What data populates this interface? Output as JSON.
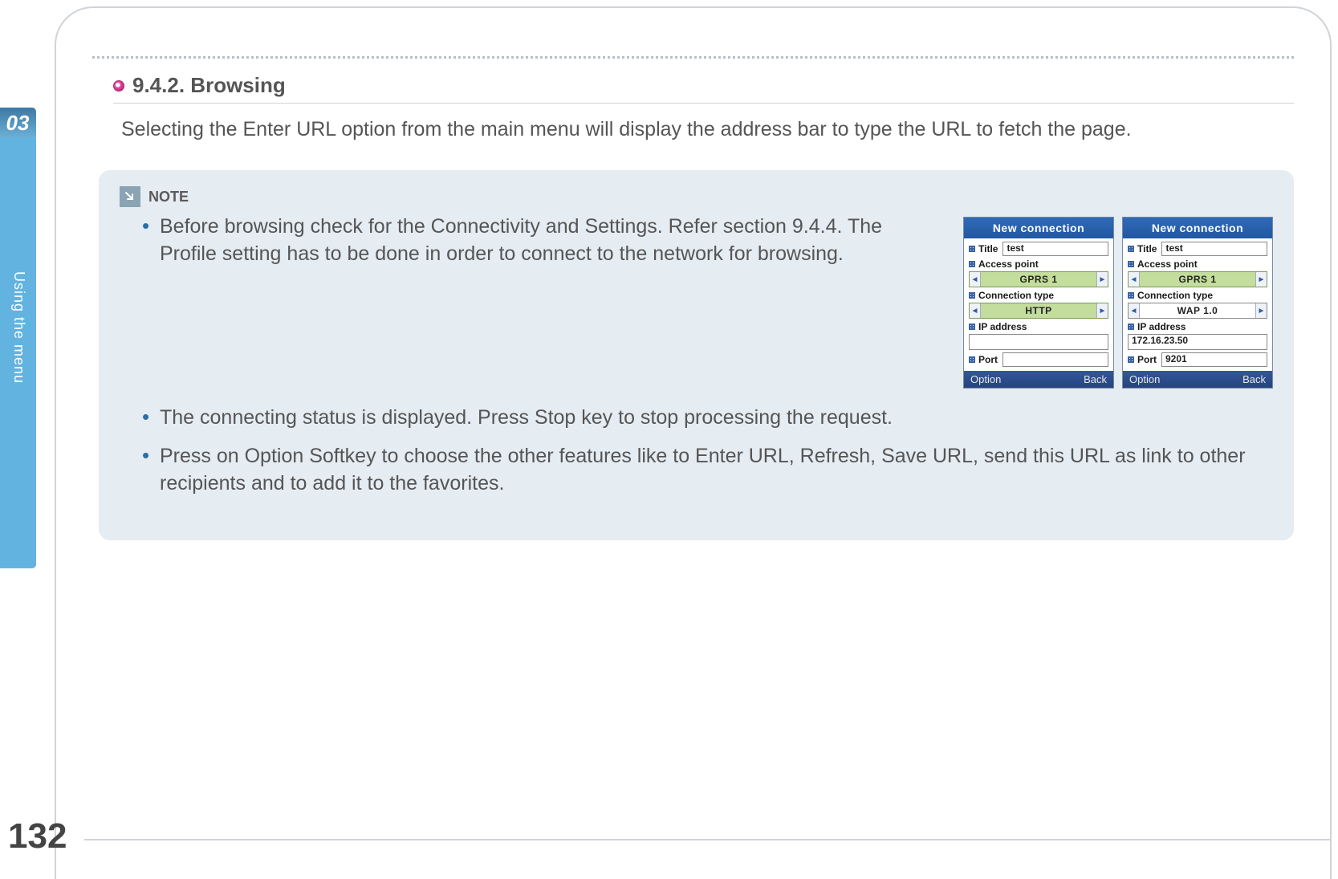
{
  "sidebar": {
    "chapter": "03",
    "vtext": "Using the menu"
  },
  "page_number": "132",
  "section": {
    "number": "9.4.2.",
    "title": "Browsing"
  },
  "intro": "Selecting the Enter URL option from the main menu will display the address bar to type the URL to fetch the page.",
  "note": {
    "label": "NOTE",
    "bullet1": "Before browsing check for the Connectivity and Settings. Refer section 9.4.4. The Profile setting has to be done in order to connect to the network for browsing.",
    "bullet2": "The connecting status is displayed. Press Stop key to stop processing the request.",
    "bullet3": "Press on Option Softkey to choose the other features like to Enter URL, Refresh, Save URL, send this URL as link to other recipients and to add it to the favorites."
  },
  "phone_labels": {
    "header": "New  connection",
    "title": "Title",
    "access_point": "Access point",
    "conn_type": "Connection type",
    "ip": "IP address",
    "port": "Port",
    "option": "Option",
    "back": "Back"
  },
  "phone1": {
    "title_val": "test",
    "access_point": "GPRS 1",
    "conn_type": "HTTP",
    "ip": "",
    "port": ""
  },
  "phone2": {
    "title_val": "test",
    "access_point": "GPRS 1",
    "conn_type": "WAP 1.0",
    "ip": "172.16.23.50",
    "port": "9201"
  }
}
